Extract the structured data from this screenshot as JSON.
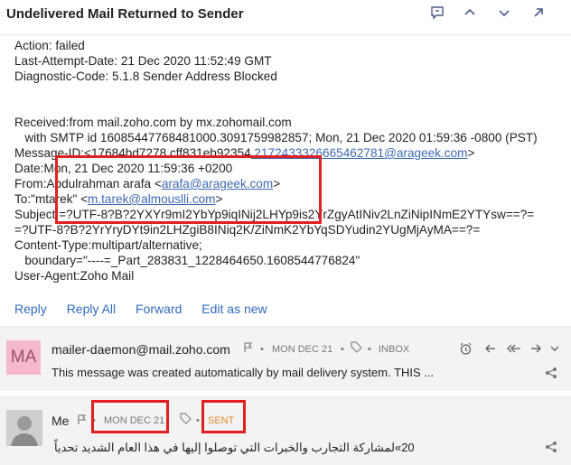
{
  "header": {
    "title": "Undelivered Mail Returned to Sender"
  },
  "message": {
    "lines": [
      "Action: failed",
      "Last-Attempt-Date: 21 Dec 2020 11:52:49 GMT",
      "Diagnostic-Code: 5.1.8 Sender Address Blocked",
      "",
      "",
      "Received:from mail.zoho.com by mx.zohomail.com",
      "   with SMTP id 16085447768481000.3091759982857; Mon, 21 Dec 2020 01:59:36 -0800 (PST)"
    ],
    "message_id_label": "Message-ID:<",
    "message_id_hidden": "17684bd7278.cff831eb92354",
    "message_id_link": ".2172433326665462781@arageek.com",
    "message_id_close": ">",
    "date_line": "Date:Mon, 21 Dec 2020 11:59:36 +0200",
    "from_label": "From:Abdulrahman arafa <",
    "from_link": "arafa@arageek.com",
    "from_close": ">",
    "to_label": "To:\"mtarek\" <",
    "to_link": "m.tarek@almouslli.com",
    "to_close": ">",
    "subject_1": "Subject:=?UTF-8?B?2YXYr9mI2YbYp9iqINij2LHYp9is2YrZgyAtINiv2LnZiNipINmE2YTYsw==?=",
    "subject_2": "=?UTF-8?B?2YrYryDYt9in2LHZgiB8INiq2K/ZiNmK2YbYqSDYudin2YUgMjAyMA==?=",
    "content_type": "Content-Type:multipart/alternative;",
    "boundary": "   boundary=\"----=_Part_283831_1228464650.1608544776824\"",
    "user_agent": "User-Agent:Zoho Mail"
  },
  "actions": {
    "reply": "Reply",
    "reply_all": "Reply All",
    "forward": "Forward",
    "edit": "Edit as new"
  },
  "thread": [
    {
      "avatar": "MA",
      "sender": "mailer-daemon@mail.zoho.com",
      "date": "MON DEC 21",
      "folder": "INBOX",
      "snippet": "This message was created automatically by mail delivery system. THIS ..."
    },
    {
      "sender": "Me",
      "date": "MON DEC 21",
      "folder": "SENT",
      "snippet": "20»لمشاركة التجارب والخبرات التي توصلوا إليها في هذا العام الشديد تحدياً"
    }
  ],
  "colors": {
    "accent_link": "#2f6bc0",
    "highlight_box": "#e02020",
    "sent_label": "#e08a2c",
    "avatar_ma": "#f6b8cc"
  }
}
